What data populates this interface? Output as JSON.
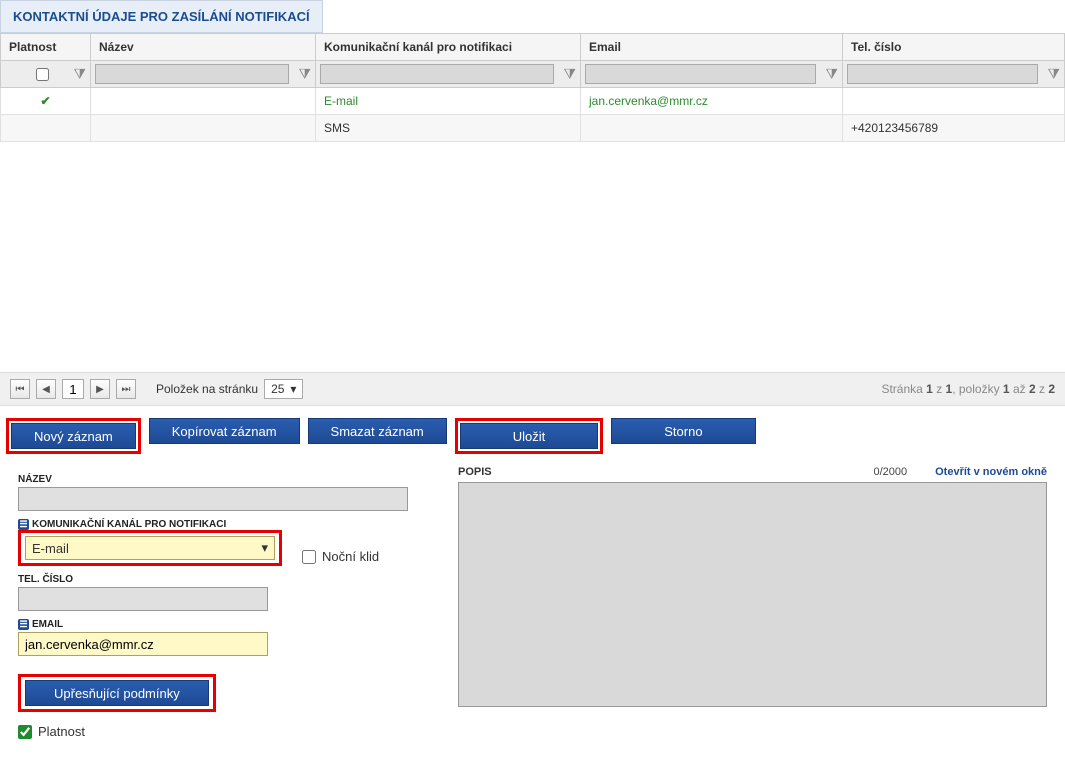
{
  "section_title": "KONTAKTNÍ ÚDAJE PRO ZASÍLÁNÍ NOTIFIKACÍ",
  "columns": {
    "platnost": "Platnost",
    "nazev": "Název",
    "kanal": "Komunikační kanál pro notifikaci",
    "email": "Email",
    "tel": "Tel. číslo"
  },
  "rows": {
    "r1": {
      "kanal": "E-mail",
      "email": "jan.cervenka@mmr.cz",
      "tel": ""
    },
    "r2": {
      "kanal": "SMS",
      "email": "",
      "tel": "+420123456789"
    }
  },
  "pager": {
    "current_page": "1",
    "per_page_label": "Položek na stránku",
    "per_page_value": "25",
    "info_prefix": "Stránka ",
    "info_page_cur": "1",
    "info_z": " z ",
    "info_page_total": "1",
    "info_polozky": ", položky ",
    "info_item_from": "1",
    "info_az": " až ",
    "info_item_to": "2",
    "info_z2": " z ",
    "info_item_total": "2"
  },
  "buttons": {
    "novy": "Nový záznam",
    "kopirovat": "Kopírovat záznam",
    "smazat": "Smazat záznam",
    "ulozit": "Uložit",
    "storno": "Storno",
    "upresnujici": "Upřesňující podmínky"
  },
  "form": {
    "nazev_label": "NÁZEV",
    "kanal_label": "KOMUNIKAČNÍ KANÁL PRO NOTIFIKACI",
    "kanal_value": "E-mail",
    "nocni_klid": "Noční klid",
    "tel_label": "TEL. ČÍSLO",
    "email_label": "EMAIL",
    "email_value": "jan.cervenka@mmr.cz",
    "platnost_label": "Platnost",
    "popis_label": "POPIS",
    "popis_counter": "0/2000",
    "popis_link": "Otevřít v novém okně"
  }
}
